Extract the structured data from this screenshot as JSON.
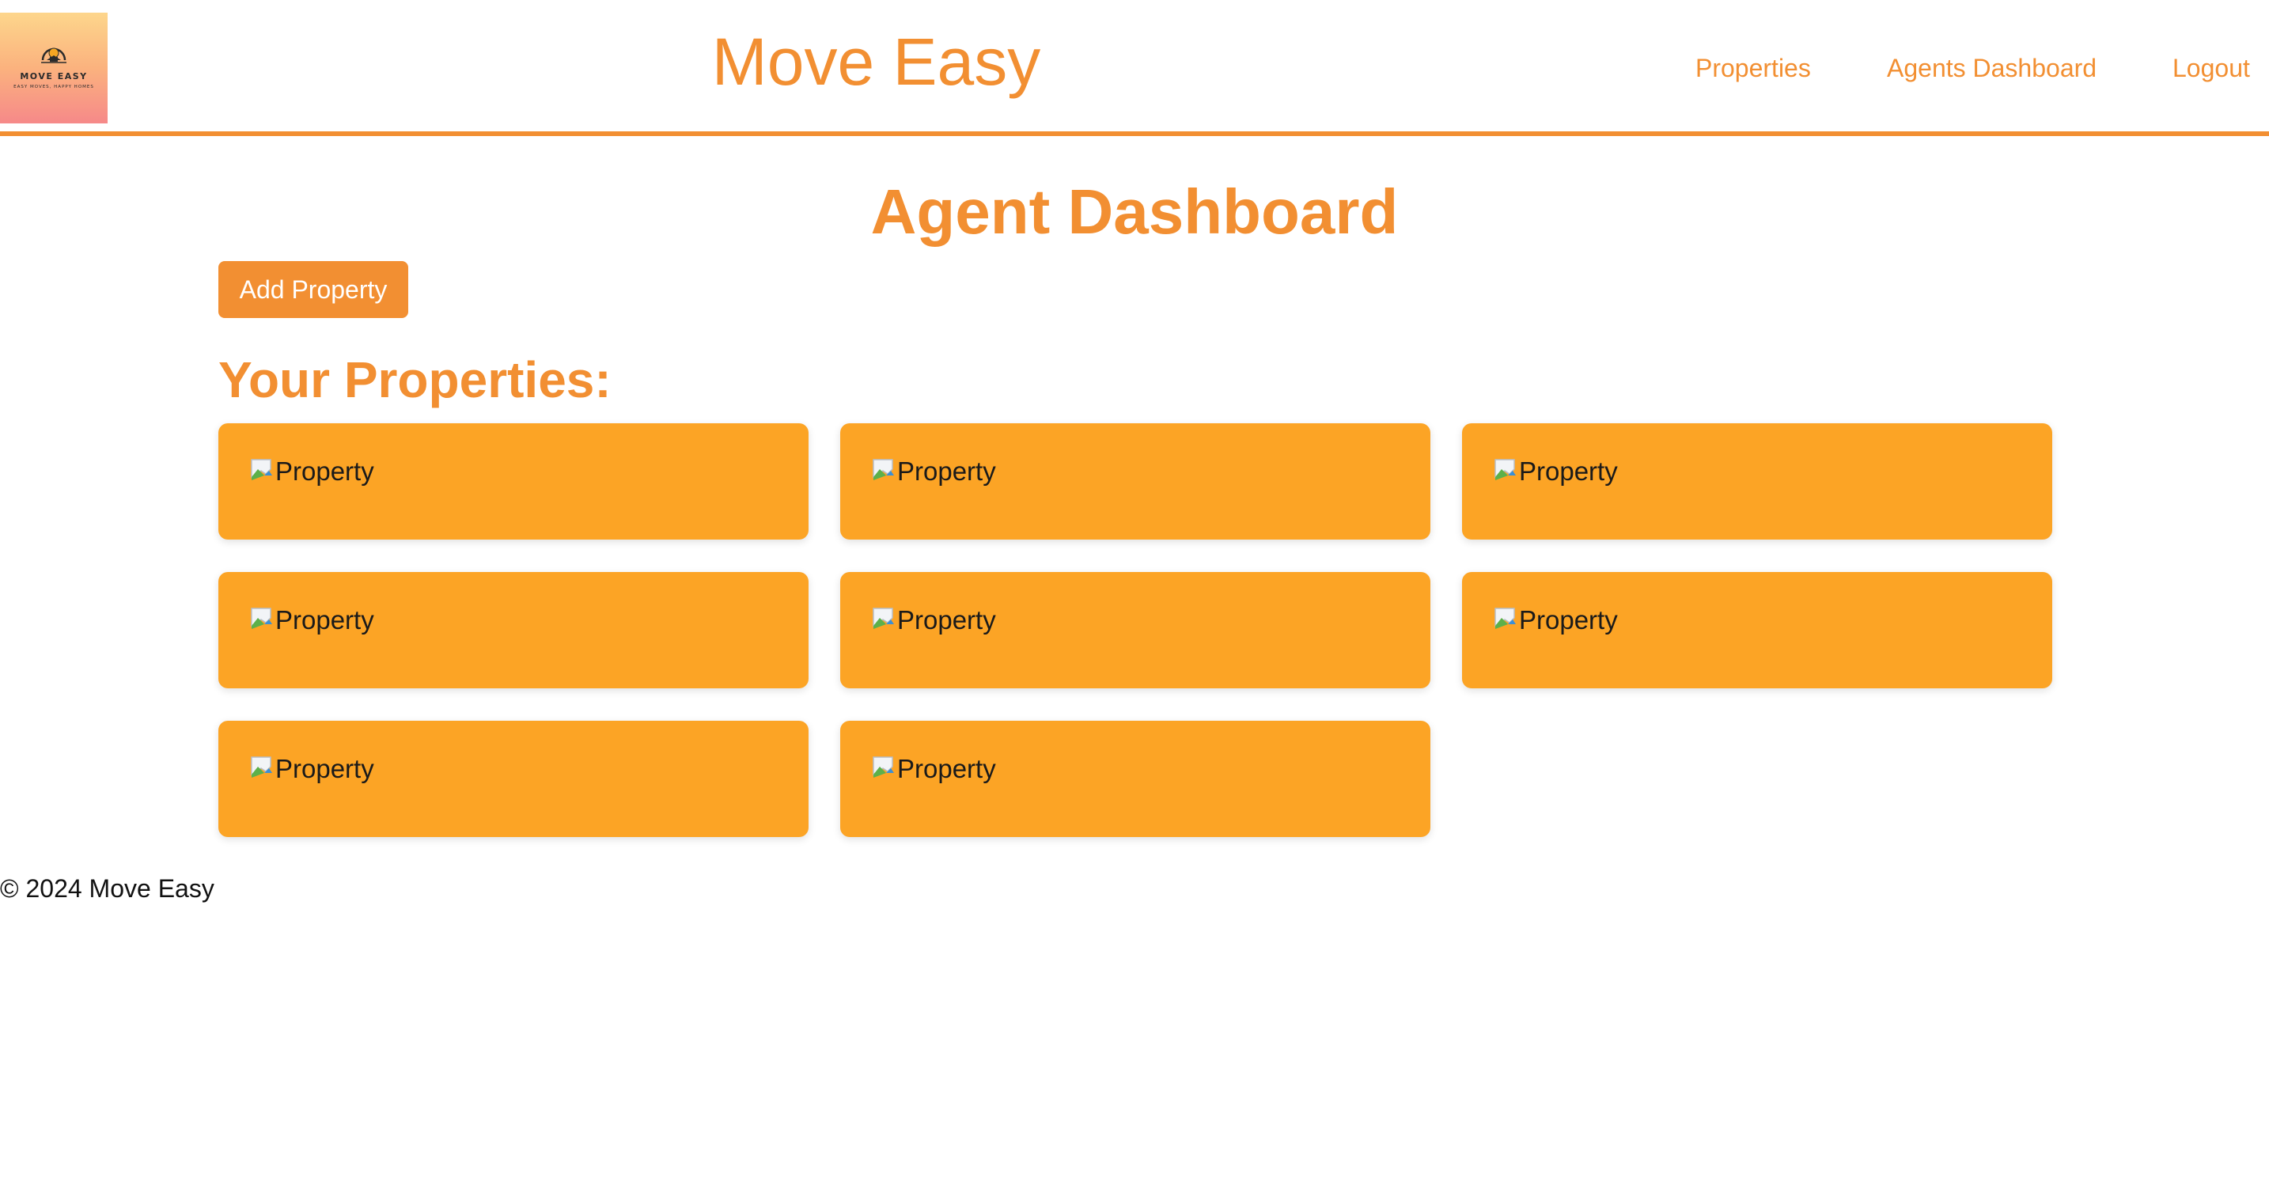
{
  "header": {
    "logo": {
      "name": "MOVE EASY",
      "tagline": "EASY MOVES, HAPPY HOMES"
    },
    "title": "Move Easy",
    "nav": {
      "properties": "Properties",
      "agents_dashboard": "Agents Dashboard",
      "logout": "Logout"
    }
  },
  "main": {
    "heading": "Agent Dashboard",
    "add_button": "Add Property",
    "section_heading": "Your Properties:",
    "properties": [
      {
        "alt": "Property"
      },
      {
        "alt": "Property"
      },
      {
        "alt": "Property"
      },
      {
        "alt": "Property"
      },
      {
        "alt": "Property"
      },
      {
        "alt": "Property"
      },
      {
        "alt": "Property"
      },
      {
        "alt": "Property"
      }
    ]
  },
  "footer": {
    "text": "© 2024 Move Easy"
  },
  "colors": {
    "accent": "#f28f32",
    "card": "#fca425",
    "text": "#111111",
    "background": "#ffffff"
  },
  "icons": {
    "logo": "sun-house-logo-icon",
    "broken_image": "broken-image-icon"
  }
}
